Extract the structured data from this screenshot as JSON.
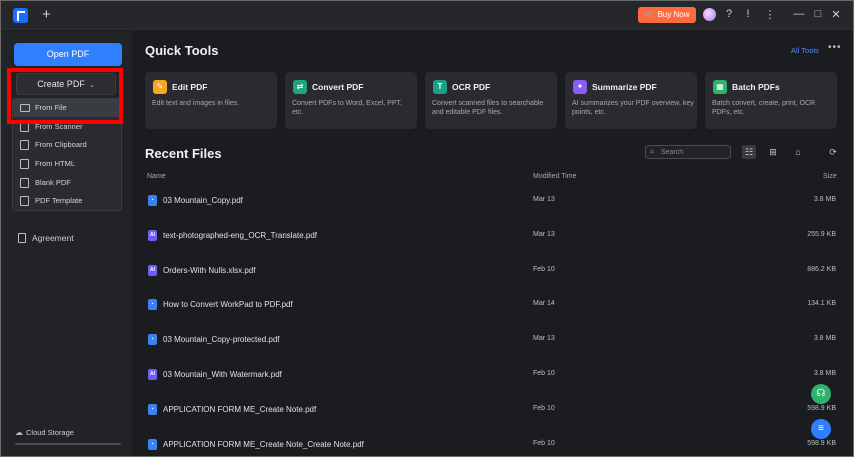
{
  "titlebar": {
    "new_tab_icon": "plus-icon",
    "buy_now_label": "Buy Now",
    "icons": [
      "avatar",
      "help-icon",
      "info-icon",
      "more-vertical-icon",
      "minimize-icon",
      "maximize-icon",
      "close-icon"
    ],
    "glyphs": {
      "help": "?",
      "info": "!",
      "more": "⋮",
      "min": "—",
      "max": "□",
      "close": "✕"
    }
  },
  "sidebar": {
    "open_pdf_label": "Open PDF",
    "create_pdf_label": "Create PDF",
    "create_chevron": "⌄",
    "dropdown": [
      "From File",
      "From Scanner",
      "From Clipboard",
      "From HTML",
      "Blank PDF",
      "PDF Template"
    ],
    "agreement_label": "Agreement",
    "cloud_storage_label": "Cloud Storage",
    "cloud_glyph": "☁"
  },
  "quick_tools": {
    "title": "Quick Tools",
    "all_tools_label": "All Tools",
    "more_glyph": "•••",
    "cards": [
      {
        "title": "Edit PDF",
        "desc": "Edit text and images in files.",
        "color": "#f5a623",
        "glyph": "✎"
      },
      {
        "title": "Convert PDF",
        "desc": "Convert PDFs to Word, Excel, PPT, etc.",
        "color": "#1fa67a",
        "glyph": "⇄"
      },
      {
        "title": "OCR PDF",
        "desc": "Convert scanned files to searchable and editable PDF files.",
        "color": "#1e9e86",
        "glyph": "T"
      },
      {
        "title": "Summarize PDF",
        "desc": "AI summarizes your PDF overview, key points, etc.",
        "color": "#8a5cf6",
        "glyph": "✦"
      },
      {
        "title": "Batch PDFs",
        "desc": "Batch convert, create, print, OCR PDFs, etc.",
        "color": "#2fb36b",
        "glyph": "▦"
      }
    ]
  },
  "recent": {
    "title": "Recent Files",
    "search_placeholder": "Search",
    "search_glyph": "⌕",
    "view_glyphs": [
      "☷",
      "⊞",
      "⌂",
      "⟳"
    ],
    "col_name": "Name",
    "col_modified": "Modified Time",
    "col_size": "Size",
    "files": [
      {
        "name": "03 Mountain_Copy.pdf",
        "time": "Mar 13",
        "size": "3.8 MB",
        "icon_color": "#3b82f6",
        "icon_glyph": "▪"
      },
      {
        "name": "text-photographed-eng_OCR_Translate.pdf",
        "time": "Mar 13",
        "size": "255.9 KB",
        "icon_color": "#6d5dfc",
        "icon_glyph": "AI"
      },
      {
        "name": "Orders-With Nulls.xlsx.pdf",
        "time": "Feb 10",
        "size": "886.2 KB",
        "icon_color": "#6d5dfc",
        "icon_glyph": "AI"
      },
      {
        "name": "How to Convert WorkPad to PDF.pdf",
        "time": "Mar 14",
        "size": "134.1 KB",
        "icon_color": "#3b82f6",
        "icon_glyph": "▪"
      },
      {
        "name": "03 Mountain_Copy-protected.pdf",
        "time": "Mar 13",
        "size": "3.8 MB",
        "icon_color": "#3b82f6",
        "icon_glyph": "▪"
      },
      {
        "name": "03 Mountain_With Watermark.pdf",
        "time": "Feb 10",
        "size": "3.8 MB",
        "icon_color": "#6d5dfc",
        "icon_glyph": "AI"
      },
      {
        "name": "APPLICATION FORM ME_Create Note.pdf",
        "time": "Feb 10",
        "size": "598.9 KB",
        "icon_color": "#3b82f6",
        "icon_glyph": "▪"
      },
      {
        "name": "APPLICATION FORM ME_Create Note_Create Note.pdf",
        "time": "Feb 10",
        "size": "598.9 KB",
        "icon_color": "#3b82f6",
        "icon_glyph": "▪"
      }
    ]
  },
  "fabs": [
    {
      "name": "support-headset-icon",
      "color": "#2fb36b",
      "glyph": "☊"
    },
    {
      "name": "feedback-icon",
      "color": "#2f80ff",
      "glyph": "≡"
    }
  ]
}
